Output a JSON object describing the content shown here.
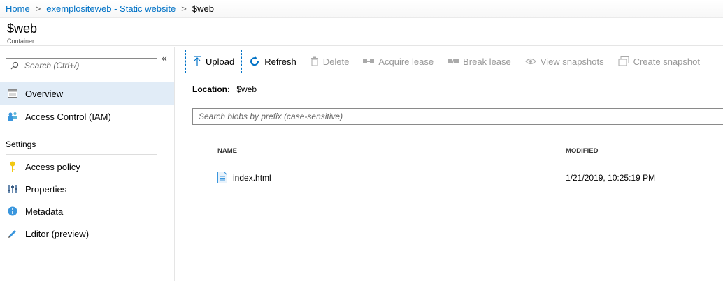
{
  "breadcrumb": {
    "home": "Home",
    "site": "exemplositeweb - Static website",
    "current": "$web",
    "sep": ">"
  },
  "header": {
    "title": "$web",
    "subtitle": "Container"
  },
  "sidebar": {
    "search_placeholder": "Search (Ctrl+/)",
    "collapse_glyph": "«",
    "items": [
      {
        "label": "Overview",
        "icon": "overview-icon"
      },
      {
        "label": "Access Control (IAM)",
        "icon": "iam-icon"
      }
    ],
    "section": "Settings",
    "settings_items": [
      {
        "label": "Access policy",
        "icon": "key-icon"
      },
      {
        "label": "Properties",
        "icon": "properties-icon"
      },
      {
        "label": "Metadata",
        "icon": "info-icon"
      },
      {
        "label": "Editor (preview)",
        "icon": "pencil-icon"
      }
    ]
  },
  "toolbar": {
    "upload": "Upload",
    "refresh": "Refresh",
    "delete": "Delete",
    "acquire_lease": "Acquire lease",
    "break_lease": "Break lease",
    "view_snapshots": "View snapshots",
    "create_snapshot": "Create snapshot"
  },
  "location": {
    "label": "Location:",
    "value": "$web"
  },
  "blob_search": {
    "placeholder": "Search blobs by prefix (case-sensitive)"
  },
  "table": {
    "columns": [
      "NAME",
      "MODIFIED"
    ],
    "rows": [
      {
        "name": "index.html",
        "modified": "1/21/2019, 10:25:19 PM"
      }
    ]
  },
  "colors": {
    "link": "#0072c6",
    "active_nav": "#e1ecf7",
    "disabled": "#999999"
  }
}
